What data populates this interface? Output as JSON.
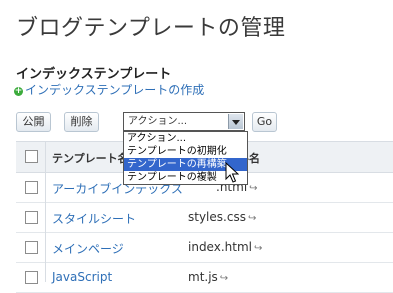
{
  "page": {
    "title": "ブログテンプレートの管理"
  },
  "section": {
    "title": "インデックステンプレート",
    "create_link": "インデックステンプレートの作成"
  },
  "toolbar": {
    "publish_label": "公開",
    "delete_label": "削除",
    "action_select_value": "アクション...",
    "go_label": "Go"
  },
  "dropdown": {
    "options": [
      {
        "label": "アクション...",
        "highlighted": false
      },
      {
        "label": "テンプレートの初期化",
        "highlighted": false
      },
      {
        "label": "テンプレートの再構築",
        "highlighted": true
      },
      {
        "label": "テンプレートの複製",
        "highlighted": false
      }
    ]
  },
  "table": {
    "headers": {
      "name": "テンプレート名",
      "file": "ル名"
    },
    "rows": [
      {
        "name": "アーカイブインデックス",
        "file": ".html"
      },
      {
        "name": "スタイルシート",
        "file": "styles.css"
      },
      {
        "name": "メインページ",
        "file": "index.html"
      },
      {
        "name": "JavaScript",
        "file": "mt.js"
      }
    ]
  },
  "colors": {
    "link": "#2e6fb7",
    "highlight": "#3366cc",
    "add_icon": "#3cab3c"
  }
}
